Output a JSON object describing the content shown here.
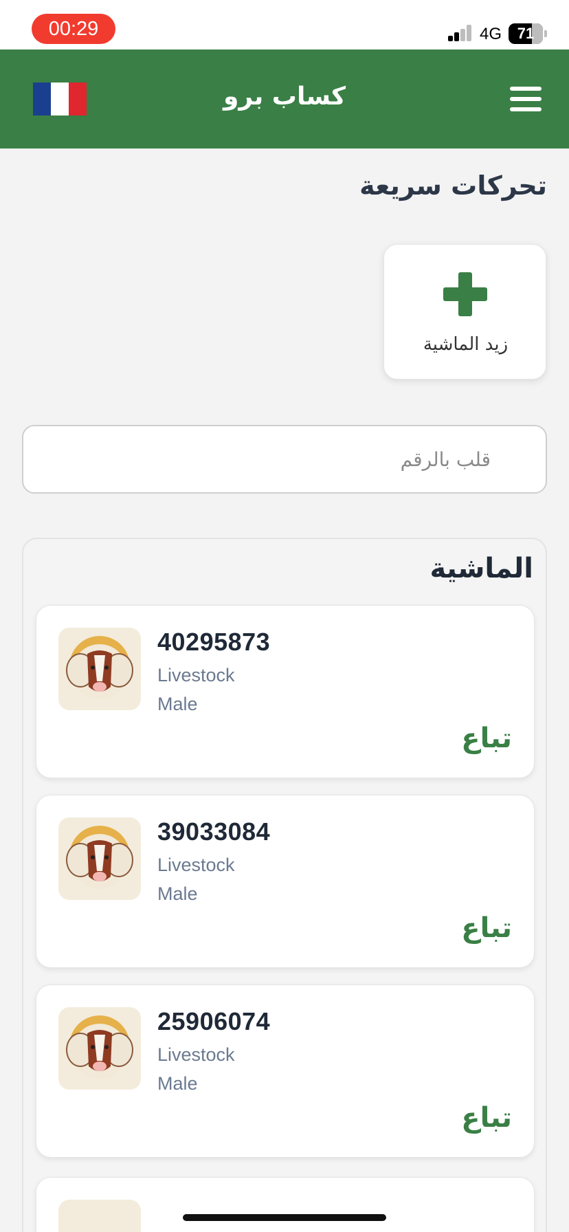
{
  "status_bar": {
    "time": "00:29",
    "network": "4G",
    "battery": "71"
  },
  "header": {
    "title": "كساب برو",
    "flag_colors": [
      "#1b3f8f",
      "#ffffff",
      "#e0262e"
    ]
  },
  "quick_actions": {
    "title": "تحركات سريعة",
    "items": [
      {
        "label": "زيد الماشية",
        "icon": "plus-icon"
      }
    ]
  },
  "search": {
    "placeholder": "قلب بالرقم",
    "value": ""
  },
  "livestock": {
    "title": "الماشية",
    "items": [
      {
        "id": "40295873",
        "type": "Livestock",
        "sex": "Male",
        "action": "تباع"
      },
      {
        "id": "39033084",
        "type": "Livestock",
        "sex": "Male",
        "action": "تباع"
      },
      {
        "id": "25906074",
        "type": "Livestock",
        "sex": "Male",
        "action": "تباع"
      }
    ]
  },
  "colors": {
    "brand_green": "#3a7f45",
    "status_red": "#f23b2f"
  }
}
